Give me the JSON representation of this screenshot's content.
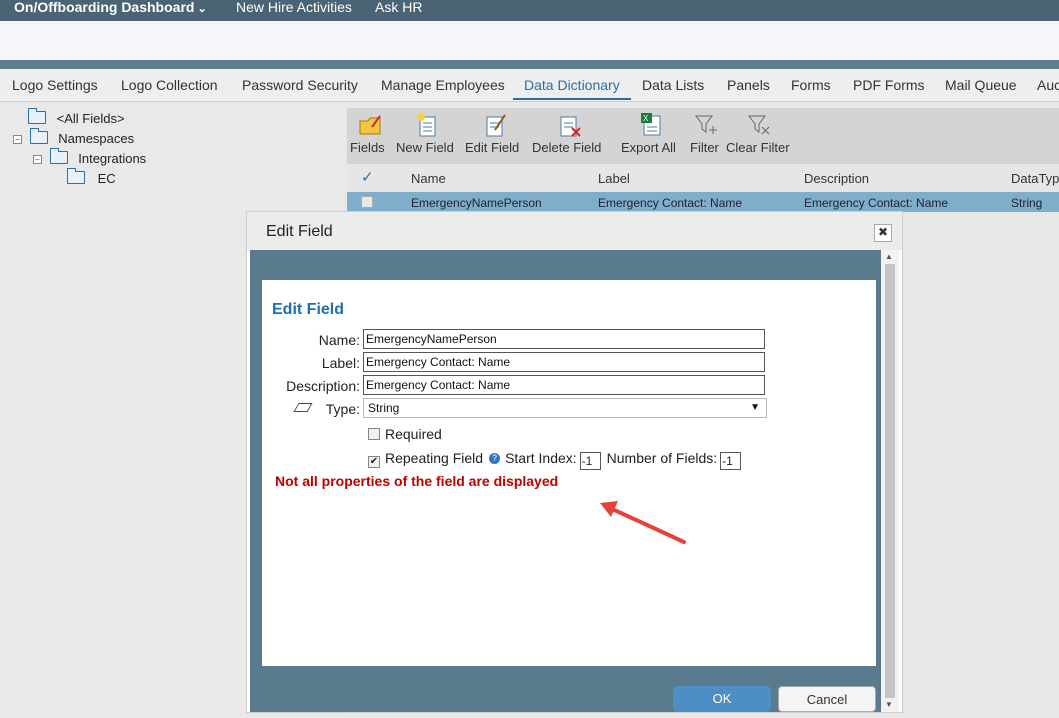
{
  "topbar": {
    "app_title": "On/Offboarding Dashboard",
    "nav": [
      "New Hire Activities",
      "Ask HR"
    ]
  },
  "tabs": [
    "Logo Settings",
    "Logo Collection",
    "Password Security",
    "Manage Employees",
    "Data Dictionary",
    "Data Lists",
    "Panels",
    "Forms",
    "PDF Forms",
    "Mail Queue",
    "Auc"
  ],
  "active_tab": "Data Dictionary",
  "tree": {
    "all_fields": "<All Fields>",
    "namespaces": "Namespaces",
    "integrations": "Integrations",
    "ec": "EC"
  },
  "toolbar": {
    "fields": "Fields",
    "new_field": "New Field",
    "edit_field": "Edit Field",
    "delete_field": "Delete Field",
    "export_all": "Export All",
    "filter": "Filter",
    "clear_filter": "Clear Filter"
  },
  "grid": {
    "columns": [
      "Name",
      "Label",
      "Description",
      "DataTyp"
    ],
    "rows": [
      {
        "name": "EmergencyNamePerson",
        "label": "Emergency Contact: Name",
        "description": "Emergency Contact: Name",
        "datatype": "String"
      }
    ]
  },
  "modal": {
    "title": "Edit Field",
    "close_glyph": "✖",
    "panel_title": "Edit Field",
    "name_label": "Name:",
    "name_value": "EmergencyNamePerson",
    "label_label": "Label:",
    "label_value": "Emergency Contact: Name",
    "description_label": "Description:",
    "description_value": "Emergency Contact: Name",
    "type_label": "Type:",
    "type_value": "String",
    "required_label": "Required",
    "required_checked": false,
    "repeating_label": "Repeating Field",
    "repeating_checked": true,
    "start_index_label": "Start Index:",
    "start_index_value": "-1",
    "number_of_fields_label": "Number of Fields:",
    "number_of_fields_value": "-1",
    "warning": "Not all properties of the field are displayed",
    "ok_label": "OK",
    "cancel_label": "Cancel"
  },
  "colors": {
    "topbar": "#4a6476",
    "accent": "#2a6ea6",
    "warning": "#c00000",
    "arrow": "#e8413b"
  }
}
